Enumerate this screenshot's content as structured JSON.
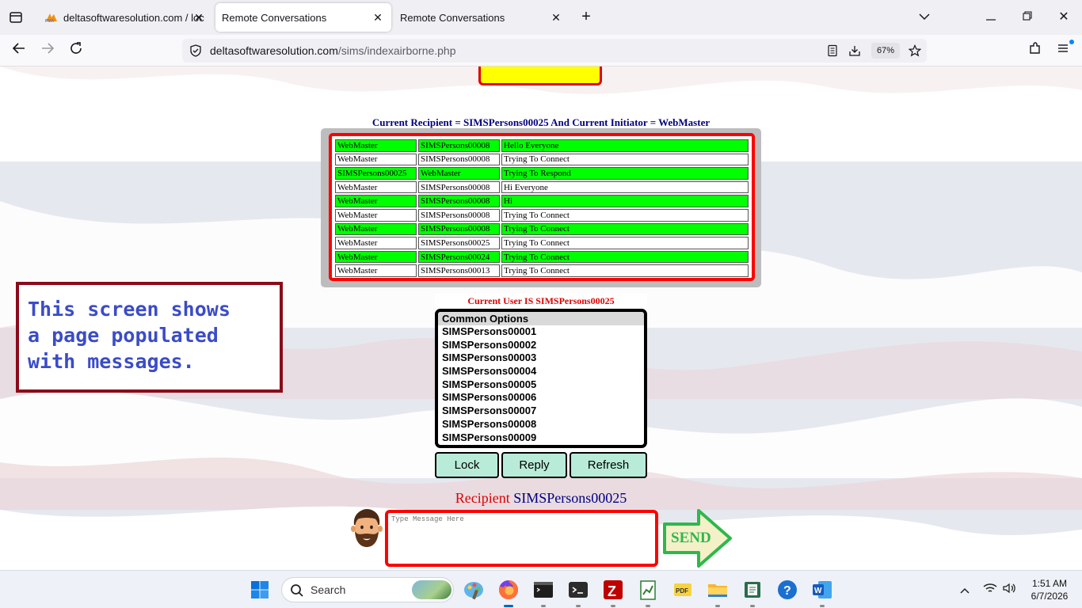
{
  "browser": {
    "tabs": [
      {
        "title": "deltasoftwaresolution.com / loc"
      },
      {
        "title": "Remote Conversations"
      },
      {
        "title": "Remote Conversations"
      }
    ],
    "url_domain": "deltasoftwaresolution.com",
    "url_path": "/sims/indexairborne.php",
    "zoom": "67%"
  },
  "conversation": {
    "heading": "Current Recipient = SIMSPersons00025 And Current Initiator = WebMaster",
    "rows": [
      {
        "from": "WebMaster",
        "to": "SIMSPersons00008",
        "message": "Hello Everyone",
        "highlight": true
      },
      {
        "from": "WebMaster",
        "to": "SIMSPersons00008",
        "message": "Trying To Connect",
        "highlight": false
      },
      {
        "from": "SIMSPersons00025",
        "to": "WebMaster",
        "message": "Trying To Respond",
        "highlight": true
      },
      {
        "from": "WebMaster",
        "to": "SIMSPersons00008",
        "message": "Hi Everyone",
        "highlight": false
      },
      {
        "from": "WebMaster",
        "to": "SIMSPersons00008",
        "message": "Hi",
        "highlight": true
      },
      {
        "from": "WebMaster",
        "to": "SIMSPersons00008",
        "message": "Trying To Connect",
        "highlight": false
      },
      {
        "from": "WebMaster",
        "to": "SIMSPersons00008",
        "message": "Trying To Connect",
        "highlight": true
      },
      {
        "from": "WebMaster",
        "to": "SIMSPersons00025",
        "message": "Trying To Connect",
        "highlight": false
      },
      {
        "from": "WebMaster",
        "to": "SIMSPersons00024",
        "message": "Trying To Connect",
        "highlight": true
      },
      {
        "from": "WebMaster",
        "to": "SIMSPersons00013",
        "message": "Trying To Connect",
        "highlight": false
      }
    ],
    "highlight_color": "#00ff00"
  },
  "current_user": "Current User IS SIMSPersons00025",
  "options": {
    "header": "Common Options",
    "items": [
      "SIMSPersons00001",
      "SIMSPersons00002",
      "SIMSPersons00003",
      "SIMSPersons00004",
      "SIMSPersons00005",
      "SIMSPersons00006",
      "SIMSPersons00007",
      "SIMSPersons00008",
      "SIMSPersons00009"
    ]
  },
  "actions": {
    "lock": "Lock",
    "reply": "Reply",
    "refresh": "Refresh"
  },
  "recipient": {
    "label": "Recipient",
    "value": "SIMSPersons00025"
  },
  "compose": {
    "placeholder": "Type Message Here",
    "send_label": "SEND"
  },
  "note": {
    "lines": [
      "This screen shows",
      "a page populated",
      "with messages."
    ]
  },
  "taskbar": {
    "search_label": "Search",
    "time": "1:51 AM",
    "date": "6/7/2026"
  }
}
